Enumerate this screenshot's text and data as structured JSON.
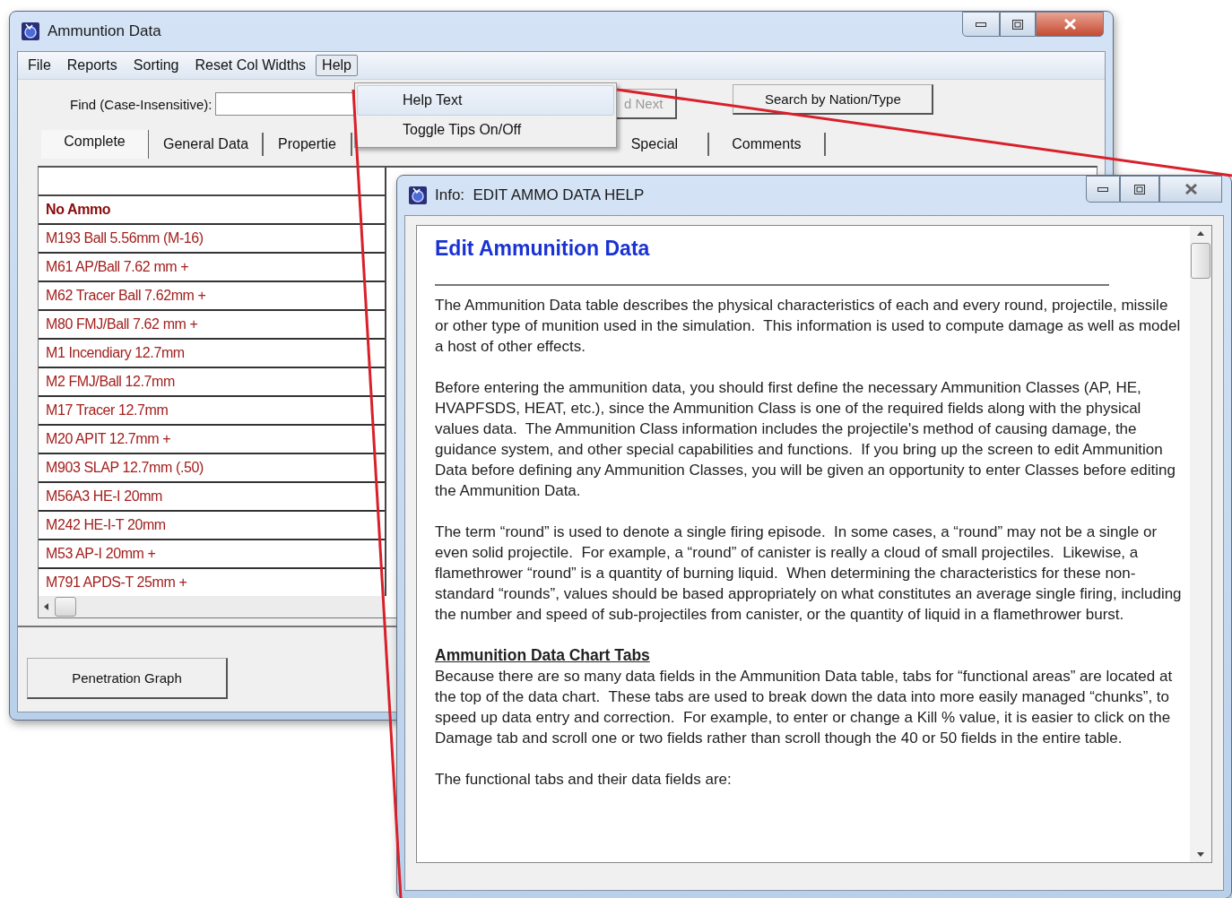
{
  "main_window": {
    "title": "Ammuntion Data",
    "menu": [
      {
        "label": "File",
        "selected": false
      },
      {
        "label": "Reports",
        "selected": false
      },
      {
        "label": "Sorting",
        "selected": false
      },
      {
        "label": "Reset Col Widths",
        "selected": false
      },
      {
        "label": "Help",
        "selected": true
      }
    ],
    "find": {
      "label": "Find (Case-Insensitive):"
    },
    "find_next_button": {
      "label": "d Next",
      "disabled": true
    },
    "search_button": {
      "label": "Search by Nation/Type",
      "disabled": false
    },
    "tabs": [
      {
        "label": "Complete",
        "selected": true
      },
      {
        "label": "General Data",
        "selected": false
      },
      {
        "label": "Propertie",
        "selected": false
      },
      {
        "label": "Special",
        "selected": false
      },
      {
        "label": "Comments",
        "selected": false
      }
    ],
    "list": [
      {
        "text": "No Ammo",
        "kind": "header"
      },
      {
        "text": "M193 Ball  5.56mm (M-16)",
        "kind": "item"
      },
      {
        "text": "M61 AP/Ball  7.62 mm +",
        "kind": "item"
      },
      {
        "text": "M62 Tracer Ball  7.62mm +",
        "kind": "item"
      },
      {
        "text": "M80 FMJ/Ball  7.62 mm +",
        "kind": "item"
      },
      {
        "text": "M1 Incendiary 12.7mm",
        "kind": "item"
      },
      {
        "text": "M2 FMJ/Ball  12.7mm",
        "kind": "item"
      },
      {
        "text": "M17 Tracer 12.7mm",
        "kind": "item"
      },
      {
        "text": "M20 APIT  12.7mm +",
        "kind": "item"
      },
      {
        "text": "M903 SLAP 12.7mm (.50)",
        "kind": "item"
      },
      {
        "text": "M56A3  HE-I 20mm",
        "kind": "item"
      },
      {
        "text": "M242  HE-I-T 20mm",
        "kind": "item"
      },
      {
        "text": "M53  AP-I 20mm +",
        "kind": "item"
      },
      {
        "text": "M791 APDS-T 25mm +",
        "kind": "item"
      }
    ],
    "buttons": [
      "Penetration Graph"
    ]
  },
  "help_menu": {
    "items": [
      {
        "label": "Help Text",
        "selected": true
      },
      {
        "label": "Toggle Tips On/Off",
        "selected": false
      }
    ]
  },
  "help_window": {
    "title": "Info:  EDIT AMMO DATA HELP",
    "heading": "Edit Ammunition Data",
    "paragraphs": [
      "The Ammunition Data table describes the physical characteristics of each and every round, projectile, missile or other type of munition used in the simulation.  This information is used to compute damage as well as model a host of other effects.",
      "Before entering the ammunition data, you should first define the necessary Ammunition Classes (AP, HE, HVAPFSDS, HEAT, etc.), since the Ammunition Class is one of the required fields along with the physical values data.  The Ammunition Class information includes the projectile's method of causing damage, the guidance system, and other special capabilities and functions.  If you bring up the screen to edit Ammunition Data before defining any Ammunition Classes, you will be given an opportunity to enter Classes before editing the Ammunition Data.",
      "The term “round” is used to denote a single firing episode.  In some cases, a “round” may not be a single or even solid projectile.  For example, a “round” of canister is really a cloud of small projectiles.  Likewise, a flamethrower “round” is a quantity of burning liquid.  When determining the characteristics for these non-standard “rounds”, values should be based appropriately on what constitutes an average single firing, including the number and speed of sub-projectiles from canister, or the quantity of liquid in a flamethrower burst."
    ],
    "section": {
      "heading": "Ammunition Data Chart Tabs",
      "paragraphs": [
        "Because there are so many data fields in the Ammunition Data table, tabs for “functional areas” are located at the top of the data chart.  These tabs are used to break down the data into more easily managed “chunks”, to speed up data entry and correction.  For example, to enter or change a Kill % value, it is easier to click on the Damage tab and scroll one or two fields rather than scroll though the 40 or 50 fields in the entire table.",
        "The functional tabs and their data fields are:"
      ]
    }
  }
}
